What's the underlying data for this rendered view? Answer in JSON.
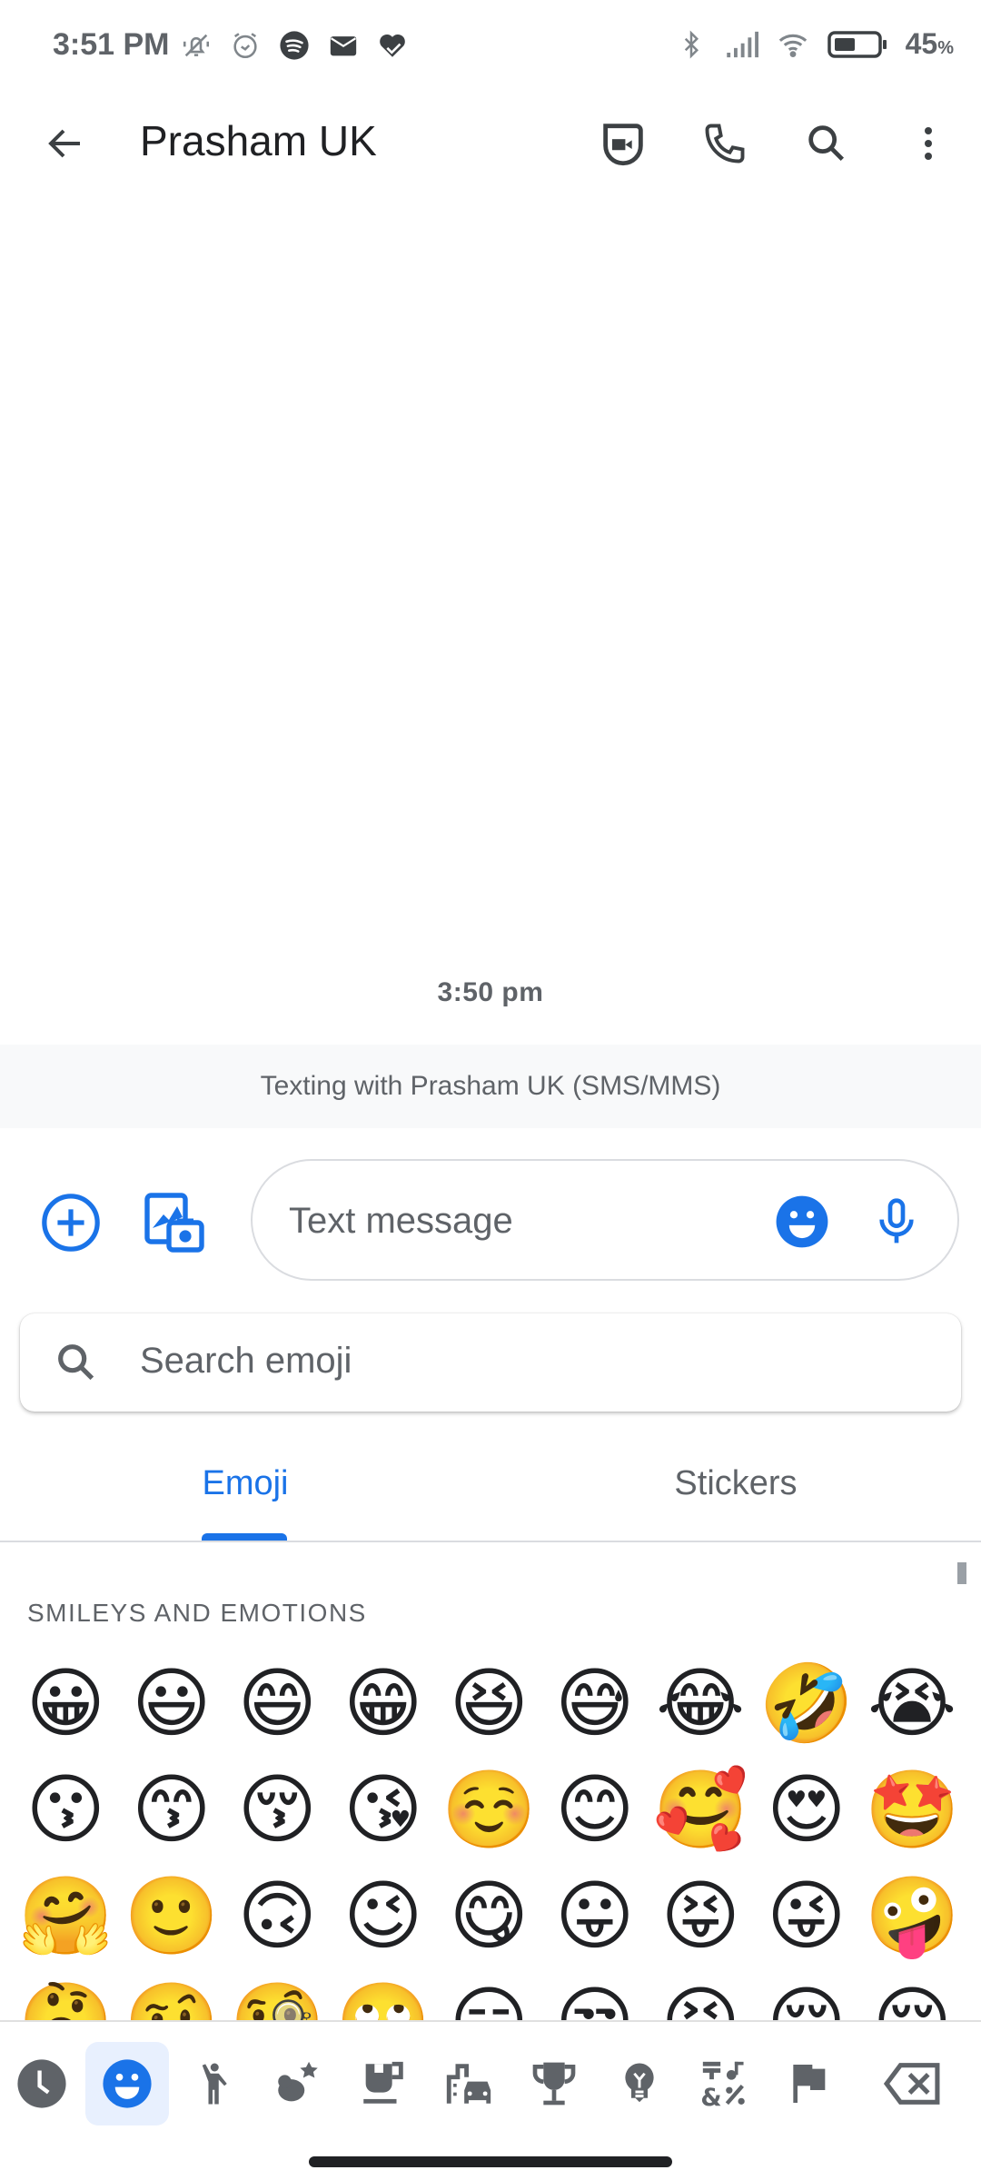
{
  "status_bar": {
    "time": "3:51 PM",
    "left_icons": [
      "vibrate-off-icon",
      "alarm-icon",
      "spotify-icon",
      "mail-icon",
      "health-heart-icon"
    ],
    "right_icons": [
      "bluetooth-icon",
      "signal-icon",
      "wifi-icon",
      "battery-icon"
    ],
    "battery_percent": "45",
    "battery_unit": "%",
    "battery_level": 0.45
  },
  "app_bar": {
    "title": "Prasham UK",
    "back_icon": "arrow-back-icon",
    "actions": [
      {
        "name": "video-call",
        "icon": "duo-video-icon"
      },
      {
        "name": "phone-call",
        "icon": "phone-icon"
      },
      {
        "name": "search",
        "icon": "search-icon"
      },
      {
        "name": "more-options",
        "icon": "more-vert-icon"
      }
    ]
  },
  "conversation": {
    "timestamp": "3:50 pm",
    "banner": "Texting with Prasham UK (SMS/MMS)"
  },
  "compose": {
    "placeholder": "Text message",
    "add_icon": "add-circle-icon",
    "gallery_icon": "gallery-camera-icon",
    "emoji_icon": "emoji-icon",
    "mic_icon": "mic-icon"
  },
  "emoji_search": {
    "placeholder": "Search emoji"
  },
  "tabs": [
    {
      "label": "Emoji",
      "active": true
    },
    {
      "label": "Stickers",
      "active": false
    }
  ],
  "section_label": "SMILEYS AND EMOTIONS",
  "emojis": [
    "😀",
    "😃",
    "😄",
    "😁",
    "😆",
    "😅",
    "😂",
    "🤣",
    "😭",
    "😗",
    "😙",
    "😚",
    "😘",
    "☺️",
    "😊",
    "🥰",
    "😍",
    "🤩",
    "🤗",
    "🙂",
    "🙃",
    "😉",
    "😋",
    "😛",
    "😝",
    "😜",
    "🤪",
    "🤔",
    "🤨",
    "🧐",
    "🙄",
    "😏",
    "😒",
    "😣",
    "😔",
    "😌"
  ],
  "categories": [
    {
      "name": "recent",
      "icon": "clock-icon",
      "active": false
    },
    {
      "name": "smileys",
      "icon": "smiley-icon",
      "active": true
    },
    {
      "name": "people",
      "icon": "person-waving-icon",
      "active": false
    },
    {
      "name": "animals-nature",
      "icon": "animals-icon",
      "active": false
    },
    {
      "name": "food-drink",
      "icon": "coffee-icon",
      "active": false
    },
    {
      "name": "travel-places",
      "icon": "city-car-icon",
      "active": false
    },
    {
      "name": "activities",
      "icon": "trophy-icon",
      "active": false
    },
    {
      "name": "objects",
      "icon": "lightbulb-icon",
      "active": false
    },
    {
      "name": "symbols",
      "icon": "symbols-icon",
      "active": false
    },
    {
      "name": "flags",
      "icon": "flag-icon",
      "active": false
    },
    {
      "name": "backspace",
      "icon": "backspace-icon",
      "active": false
    }
  ],
  "colors": {
    "accent": "#1a73e8",
    "icon_gray": "#5f6368",
    "banner_bg": "#f8f9fa"
  }
}
